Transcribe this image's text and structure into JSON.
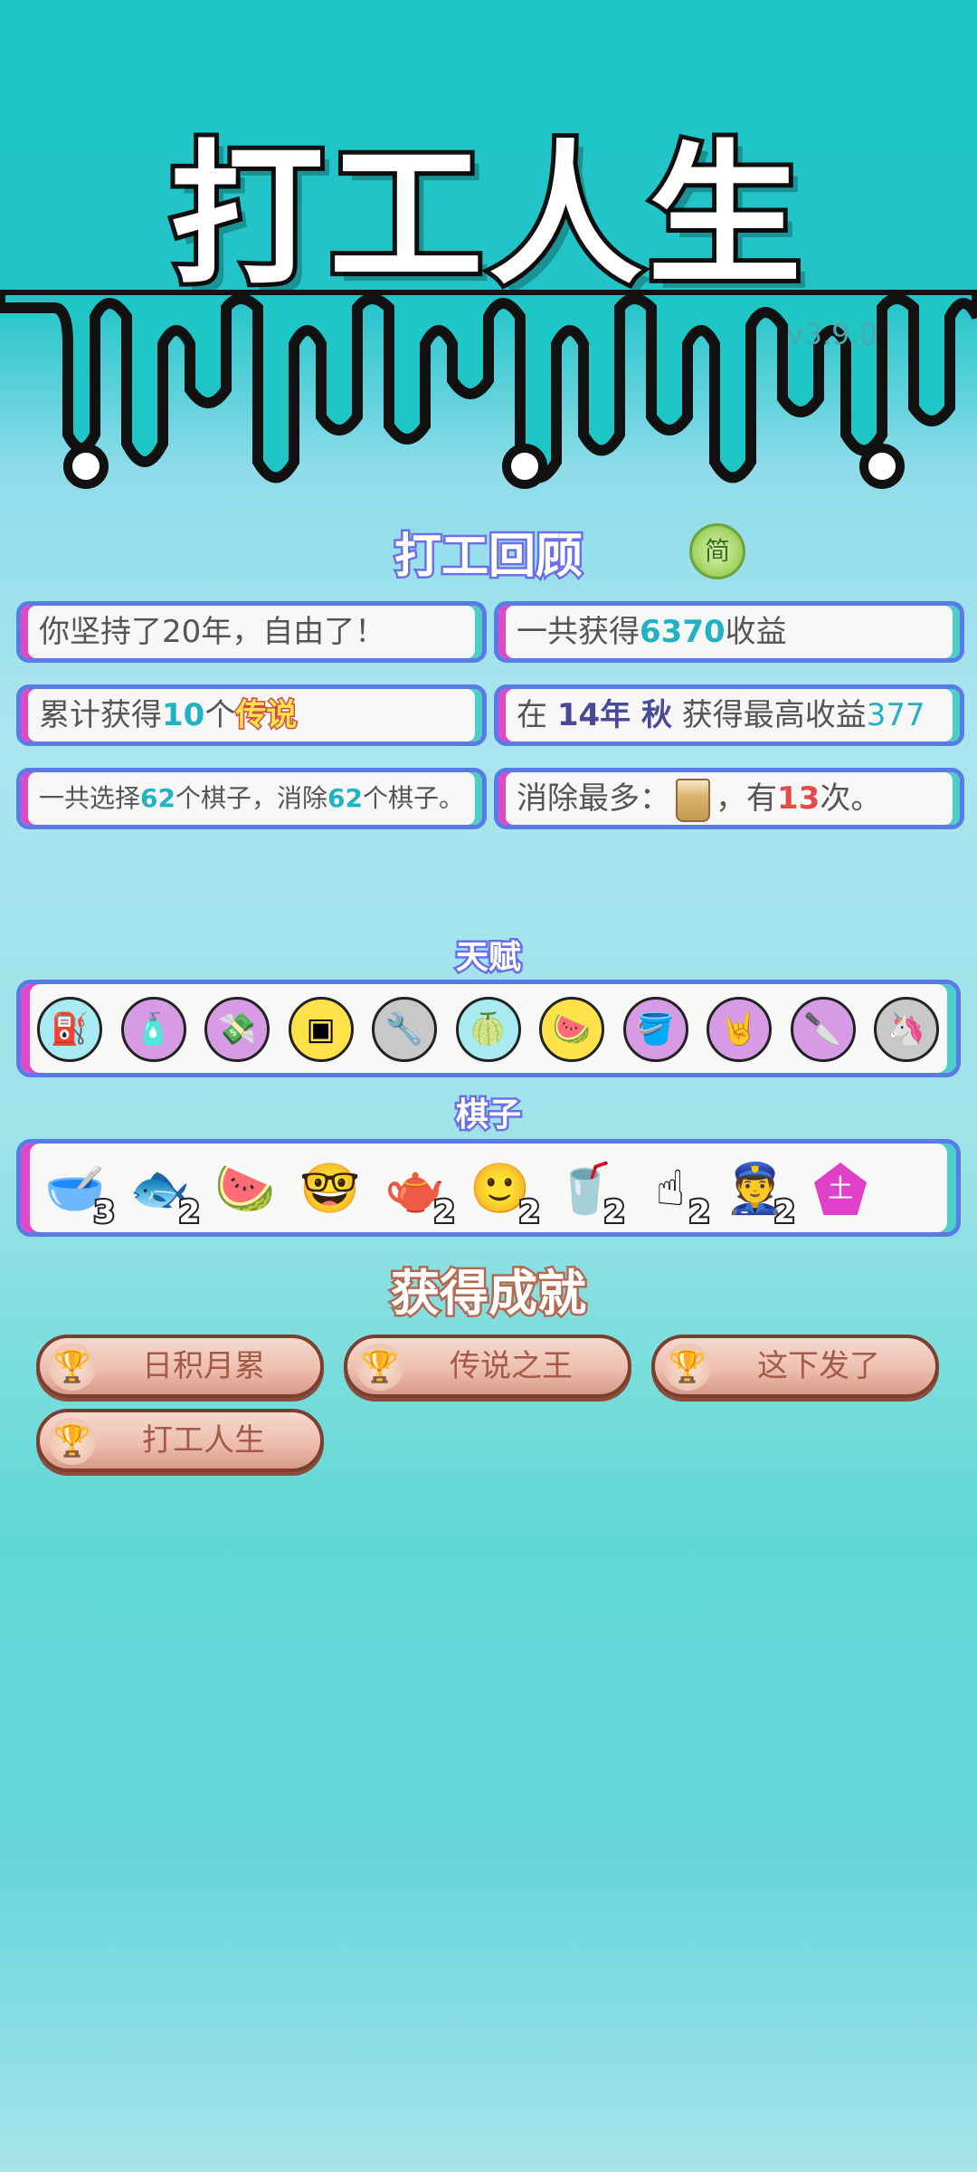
{
  "header": {
    "title": "打工人生",
    "version": "v3.9.0"
  },
  "review": {
    "title": "打工回顾",
    "simplified_badge": "简",
    "cards": {
      "persist": {
        "prefix": "你坚持了20年，自由了！"
      },
      "total_income": {
        "prefix": "一共获得",
        "value": "6370",
        "suffix": "收益"
      },
      "legends": {
        "prefix": "累计获得",
        "value": "10",
        "mid": "个",
        "word": "传说"
      },
      "best": {
        "prefix": "在 ",
        "year": "14年 秋",
        "mid": " 获得最高收益",
        "value": "377"
      },
      "pieces": {
        "a": "一共选择",
        "v1": "62",
        "b": "个棋子，消除",
        "v2": "62",
        "c": "个棋子。"
      },
      "most_removed": {
        "prefix": "消除最多：",
        "mid": "，有",
        "value": "13",
        "suffix": "次。"
      }
    }
  },
  "talents": {
    "title": "天赋",
    "items": [
      {
        "icon": "pump-icon",
        "bg": "#a8eaf2"
      },
      {
        "icon": "sprayer-icon",
        "bg": "#d79be6"
      },
      {
        "icon": "money-rain-icon",
        "bg": "#d79be6"
      },
      {
        "icon": "chip-icon",
        "bg": "#ffe14a"
      },
      {
        "icon": "wrench-shield-icon",
        "bg": "#c8c8c8"
      },
      {
        "icon": "pomelo-icon",
        "bg": "#a8eaf2"
      },
      {
        "icon": "fruit-bowl-icon",
        "bg": "#ffe14a"
      },
      {
        "icon": "bucket-100-icon",
        "bg": "#d79be6"
      },
      {
        "icon": "rock-hand-icon",
        "bg": "#d79be6"
      },
      {
        "icon": "cleaver-icon",
        "bg": "#d79be6"
      },
      {
        "icon": "twin-unicorn-icon",
        "bg": "#c8c8c8"
      }
    ]
  },
  "pieces": {
    "title": "棋子",
    "items": [
      {
        "icon": "bowl-icon",
        "glyph": "🥣",
        "count": "3"
      },
      {
        "icon": "koi-icon",
        "glyph": "🐟",
        "count": "2"
      },
      {
        "icon": "watermelon-icon",
        "glyph": "🍉",
        "count": ""
      },
      {
        "icon": "nerd-face-icon",
        "glyph": "🤓",
        "count": ""
      },
      {
        "icon": "teapot-icon",
        "glyph": "🫖",
        "count": "2"
      },
      {
        "icon": "face-icon",
        "glyph": "🙂",
        "count": "2"
      },
      {
        "icon": "boba-cup-icon",
        "glyph": "🥤",
        "count": "2"
      },
      {
        "icon": "pointing-hand-icon",
        "glyph": "☝",
        "count": "2"
      },
      {
        "icon": "police-icon",
        "glyph": "👮",
        "count": "2"
      },
      {
        "icon": "pentagon-earth-icon",
        "glyph": "土",
        "count": ""
      }
    ]
  },
  "achievements": {
    "title": "获得成就",
    "items": [
      {
        "label": "日积月累"
      },
      {
        "label": "传说之王"
      },
      {
        "label": "这下发了"
      },
      {
        "label": "打工人生"
      }
    ]
  }
}
